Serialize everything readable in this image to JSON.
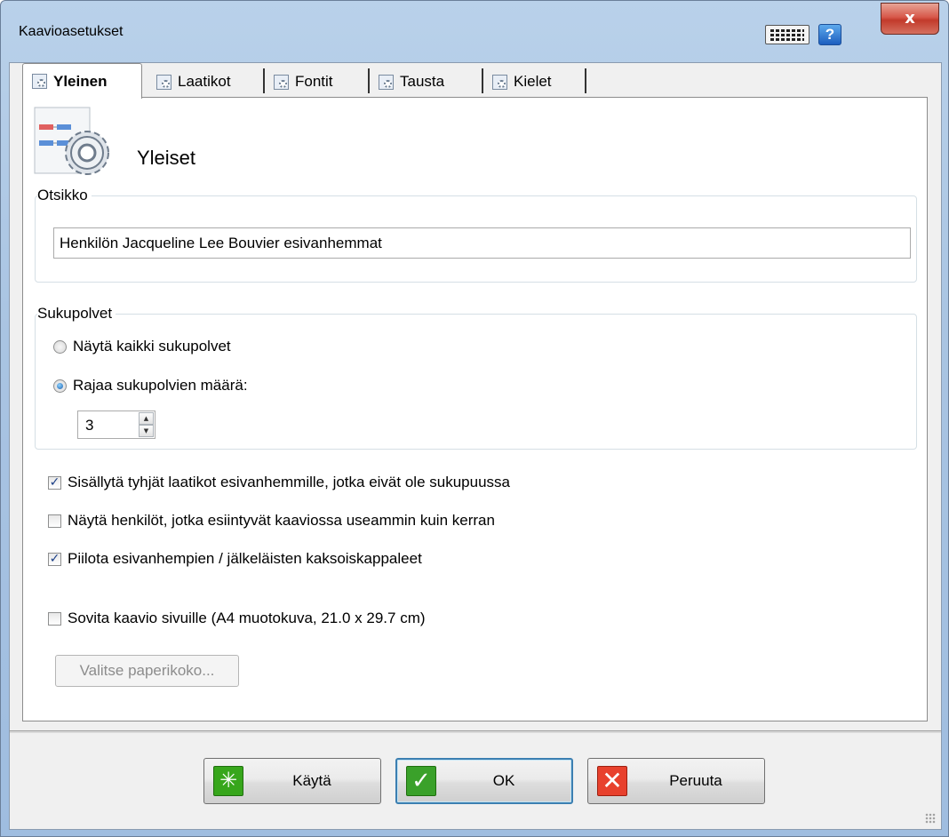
{
  "window": {
    "title": "Kaavioasetukset",
    "close_label": "x",
    "help_label": "?"
  },
  "tabs": [
    {
      "label": "Yleinen",
      "icon": "settings-gear-icon",
      "active": true
    },
    {
      "label": "Laatikot",
      "icon": "settings-gear-icon",
      "active": false
    },
    {
      "label": "Fontit",
      "icon": "settings-gear-icon",
      "active": false
    },
    {
      "label": "Tausta",
      "icon": "settings-gear-icon",
      "active": false
    },
    {
      "label": "Kielet",
      "icon": "settings-gear-icon",
      "active": false
    }
  ],
  "panel": {
    "title": "Yleiset",
    "title_group": {
      "legend": "Otsikko",
      "value": "Henkilön Jacqueline Lee Bouvier esivanhemmat"
    },
    "generations_group": {
      "legend": "Sukupolvet",
      "option_all": "Näytä kaikki sukupolvet",
      "option_limit": "Rajaa sukupolvien määrä:",
      "selected": "limit",
      "count": "3"
    },
    "checkboxes": [
      {
        "label": "Sisällytä tyhjät laatikot esivanhemmille, jotka eivät ole sukupuussa",
        "checked": true
      },
      {
        "label": "Näytä henkilöt, jotka esiintyvät kaaviossa useammin kuin kerran",
        "checked": false
      },
      {
        "label": "Piilota esivanhempien / jälkeläisten kaksoiskappaleet",
        "checked": true
      }
    ],
    "fit_pages": {
      "label": "Sovita kaavio sivuille (A4 muotokuva, 21.0 x 29.7 cm)",
      "checked": false
    },
    "paper_button": "Valitse paperikoko..."
  },
  "buttons": {
    "apply": "Käytä",
    "ok": "OK",
    "cancel": "Peruuta"
  },
  "colors": {
    "title_bar": "#b9d1ea",
    "close_button": "#c23a2b",
    "default_button_border": "#3c7fb1",
    "checkmark": "#1b3f86"
  }
}
